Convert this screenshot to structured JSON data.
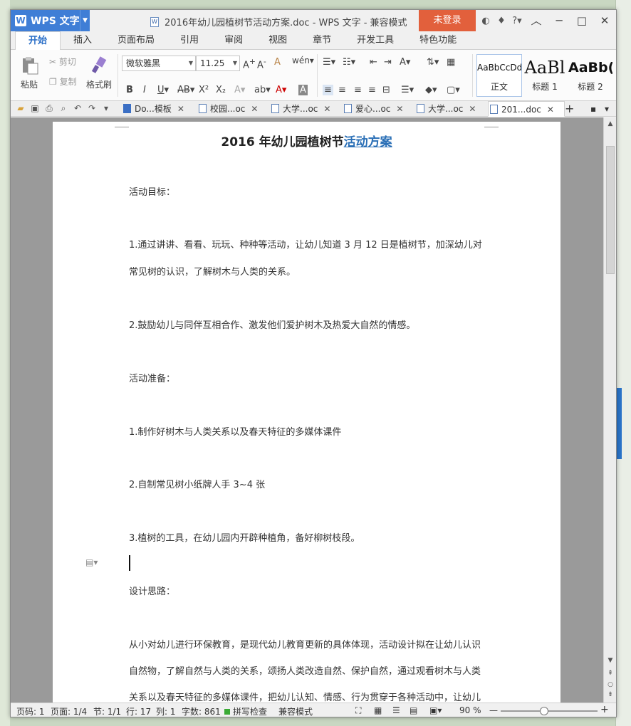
{
  "window": {
    "app_button": "WPS 文字",
    "title": "2016年幼儿园植树节活动方案.doc - WPS 文字 - 兼容模式",
    "login": "未登录"
  },
  "ribbon_tabs": [
    "开始",
    "插入",
    "页面布局",
    "引用",
    "审阅",
    "视图",
    "章节",
    "开发工具",
    "特色功能"
  ],
  "ribbon": {
    "paste": "粘贴",
    "cut": "剪切",
    "copy": "复制",
    "format_painter": "格式刷",
    "font_name": "微软雅黑",
    "font_size": "11.25",
    "styles": [
      {
        "preview": "AaBbCcDd",
        "label": "正文"
      },
      {
        "preview": "AaBl",
        "label": "标题 1"
      },
      {
        "preview": "AaBb(",
        "label": "标题 2"
      }
    ]
  },
  "doc_tabs": [
    "Do...模板",
    "校园...oc",
    "大学...oc",
    "爱心...oc",
    "大学...oc",
    "201...doc"
  ],
  "document": {
    "title_plain": "2016 年幼儿园植树节",
    "title_link": "活动方案",
    "lines": [
      "活动目标：",
      "1.通过讲讲、看看、玩玩、种种等活动，让幼儿知道 3 月 12 日是植树节，加深幼儿对",
      "常见树的认识，了解树木与人类的关系。",
      "2.鼓励幼儿与同伴互相合作、激发他们爱护树木及热爱大自然的情感。",
      "活动准备：",
      "1.制作好树木与人类关系以及春天特征的多媒体课件",
      "2.自制常见树小纸牌人手 3~4 张",
      "3.植树的工具，在幼儿园内开辟种植角，备好柳树枝段。",
      "设计思路：",
      "从小对幼儿进行环保教育，是现代幼儿教育更新的具体体现，活动设计拟在让幼儿认识",
      "自然物，了解自然与人类的关系，颂扬人类改造自然、保护自然，通过观看树木与人类",
      "关系以及春天特征的多媒体课件，把幼儿认知、情感、行为贯穿于各种活动中，让幼儿"
    ]
  },
  "status": {
    "page_no": "页码: 1",
    "pages": "页面: 1/4",
    "section": "节: 1/1",
    "row": "行: 17",
    "col": "列: 1",
    "words": "字数: 861",
    "spell": "拼写检查",
    "mode": "兼容模式",
    "zoom": "90 %"
  },
  "zoom_level": 0.45
}
